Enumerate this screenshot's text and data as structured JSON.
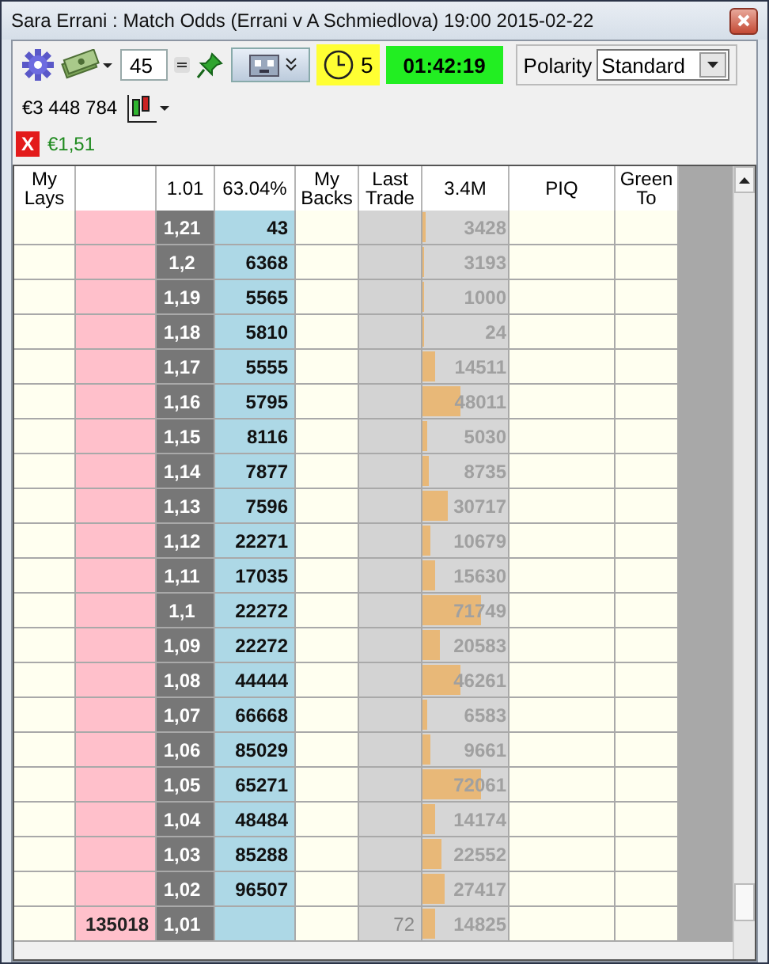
{
  "window": {
    "title": "Sara Errani : Match Odds (Errani v A Schmiedlova) 19:00 2015-02-22"
  },
  "toolbar": {
    "stake": "45",
    "delay": "5",
    "timer": "01:42:19",
    "polarity": {
      "label": "Polarity",
      "value": "Standard"
    }
  },
  "balance": "€3 448 784",
  "status": {
    "close": "X",
    "profit": "€1,51"
  },
  "ladder": {
    "header": {
      "my_lays": "My Lays",
      "last_price": "1.01",
      "percent": "63.04%",
      "my_backs": "My Backs",
      "last_trade": "Last Trade",
      "total_volume": "3.4M",
      "piq": "PIQ",
      "green_to": "Green To"
    },
    "rows": [
      {
        "price": "1,21",
        "back": "43",
        "volume": "3428",
        "level": 0.03
      },
      {
        "price": "1,2",
        "back": "6368",
        "volume": "3193",
        "level": 0.02
      },
      {
        "price": "1,19",
        "back": "5565",
        "volume": "1000",
        "level": 0.01
      },
      {
        "price": "1,18",
        "back": "5810",
        "volume": "24",
        "level": 0.01
      },
      {
        "price": "1,17",
        "back": "5555",
        "volume": "14511",
        "level": 0.14
      },
      {
        "price": "1,16",
        "back": "5795",
        "volume": "48011",
        "level": 0.45
      },
      {
        "price": "1,15",
        "back": "8116",
        "volume": "5030",
        "level": 0.05
      },
      {
        "price": "1,14",
        "back": "7877",
        "volume": "8735",
        "level": 0.08
      },
      {
        "price": "1,13",
        "back": "7596",
        "volume": "30717",
        "level": 0.3
      },
      {
        "price": "1,12",
        "back": "22271",
        "volume": "10679",
        "level": 0.1
      },
      {
        "price": "1,11",
        "back": "17035",
        "volume": "15630",
        "level": 0.15
      },
      {
        "price": "1,1",
        "back": "22272",
        "volume": "71749",
        "level": 0.68
      },
      {
        "price": "1,09",
        "back": "22272",
        "volume": "20583",
        "level": 0.2
      },
      {
        "price": "1,08",
        "back": "44444",
        "volume": "46261",
        "level": 0.44
      },
      {
        "price": "1,07",
        "back": "66668",
        "volume": "6583",
        "level": 0.06
      },
      {
        "price": "1,06",
        "back": "85029",
        "volume": "9661",
        "level": 0.09
      },
      {
        "price": "1,05",
        "back": "65271",
        "volume": "72061",
        "level": 0.68
      },
      {
        "price": "1,04",
        "back": "48484",
        "volume": "14174",
        "level": 0.14
      },
      {
        "price": "1,03",
        "back": "85288",
        "volume": "22552",
        "level": 0.22
      },
      {
        "price": "1,02",
        "back": "96507",
        "volume": "27417",
        "level": 0.26
      },
      {
        "price": "1,01",
        "lay": "135018",
        "last_trade": "72",
        "volume": "14825",
        "level": 0.14
      }
    ]
  }
}
